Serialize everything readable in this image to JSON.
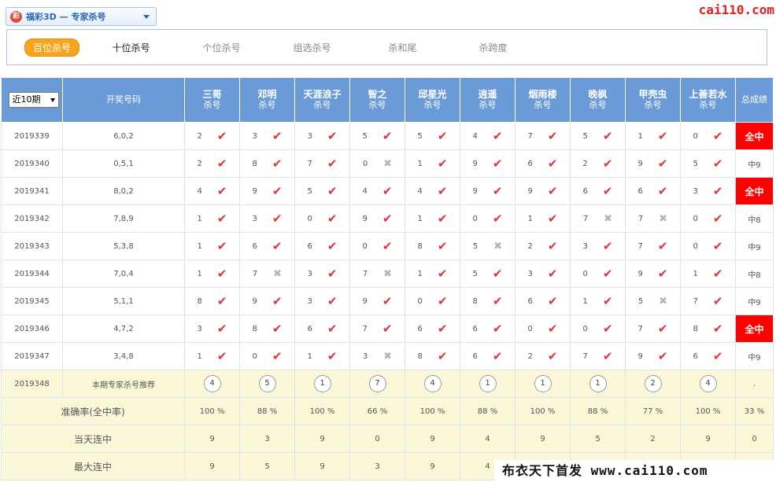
{
  "header": {
    "logo_glyph": "彩",
    "selector_text": "福彩3D — 专家杀号",
    "brand": "cai110.com"
  },
  "tabs": [
    {
      "label": "百位杀号",
      "active": true
    },
    {
      "label": "十位杀号",
      "active": false
    },
    {
      "label": "个位杀号",
      "active": false
    },
    {
      "label": "组选杀号",
      "active": false
    },
    {
      "label": "杀和尾",
      "active": false
    },
    {
      "label": "杀跨度",
      "active": false
    }
  ],
  "table": {
    "period_select": "近10期",
    "col_draw": "开奖号码",
    "col_total": "总成绩",
    "expert_sub": "杀号",
    "experts": [
      "三哥",
      "邓明",
      "天涯浪子",
      "智之",
      "邱星光",
      "逍遥",
      "烟雨楼",
      "晚枫",
      "甲壳虫",
      "上善若水"
    ],
    "rows": [
      {
        "issue": "2019339",
        "draw": "6,0,2",
        "picks": [
          [
            "2",
            true
          ],
          [
            "3",
            true
          ],
          [
            "3",
            true
          ],
          [
            "5",
            true
          ],
          [
            "5",
            true
          ],
          [
            "4",
            true
          ],
          [
            "7",
            true
          ],
          [
            "5",
            true
          ],
          [
            "1",
            true
          ],
          [
            "0",
            true
          ]
        ],
        "total": "全中",
        "full": true
      },
      {
        "issue": "2019340",
        "draw": "0,5,1",
        "picks": [
          [
            "2",
            true
          ],
          [
            "8",
            true
          ],
          [
            "7",
            true
          ],
          [
            "0",
            false
          ],
          [
            "1",
            true
          ],
          [
            "9",
            true
          ],
          [
            "6",
            true
          ],
          [
            "2",
            true
          ],
          [
            "9",
            true
          ],
          [
            "5",
            true
          ]
        ],
        "total": "中9",
        "full": false
      },
      {
        "issue": "2019341",
        "draw": "8,0,2",
        "picks": [
          [
            "4",
            true
          ],
          [
            "9",
            true
          ],
          [
            "5",
            true
          ],
          [
            "4",
            true
          ],
          [
            "4",
            true
          ],
          [
            "9",
            true
          ],
          [
            "9",
            true
          ],
          [
            "6",
            true
          ],
          [
            "6",
            true
          ],
          [
            "3",
            true
          ]
        ],
        "total": "全中",
        "full": true
      },
      {
        "issue": "2019342",
        "draw": "7,8,9",
        "picks": [
          [
            "1",
            true
          ],
          [
            "3",
            true
          ],
          [
            "0",
            true
          ],
          [
            "9",
            true
          ],
          [
            "1",
            true
          ],
          [
            "0",
            true
          ],
          [
            "1",
            true
          ],
          [
            "7",
            false
          ],
          [
            "7",
            false
          ],
          [
            "0",
            true
          ]
        ],
        "total": "中8",
        "full": false
      },
      {
        "issue": "2019343",
        "draw": "5,3,8",
        "picks": [
          [
            "1",
            true
          ],
          [
            "6",
            true
          ],
          [
            "6",
            true
          ],
          [
            "0",
            true
          ],
          [
            "8",
            true
          ],
          [
            "5",
            false
          ],
          [
            "2",
            true
          ],
          [
            "3",
            true
          ],
          [
            "7",
            true
          ],
          [
            "0",
            true
          ]
        ],
        "total": "中9",
        "full": false
      },
      {
        "issue": "2019344",
        "draw": "7,0,4",
        "picks": [
          [
            "1",
            true
          ],
          [
            "7",
            false
          ],
          [
            "3",
            true
          ],
          [
            "7",
            false
          ],
          [
            "1",
            true
          ],
          [
            "5",
            true
          ],
          [
            "3",
            true
          ],
          [
            "0",
            true
          ],
          [
            "9",
            true
          ],
          [
            "1",
            true
          ]
        ],
        "total": "中8",
        "full": false
      },
      {
        "issue": "2019345",
        "draw": "5,1,1",
        "picks": [
          [
            "8",
            true
          ],
          [
            "9",
            true
          ],
          [
            "3",
            true
          ],
          [
            "9",
            true
          ],
          [
            "0",
            true
          ],
          [
            "8",
            true
          ],
          [
            "6",
            true
          ],
          [
            "1",
            true
          ],
          [
            "5",
            false
          ],
          [
            "7",
            true
          ]
        ],
        "total": "中9",
        "full": false
      },
      {
        "issue": "2019346",
        "draw": "4,7,2",
        "picks": [
          [
            "3",
            true
          ],
          [
            "8",
            true
          ],
          [
            "6",
            true
          ],
          [
            "7",
            true
          ],
          [
            "6",
            true
          ],
          [
            "6",
            true
          ],
          [
            "0",
            true
          ],
          [
            "0",
            true
          ],
          [
            "7",
            true
          ],
          [
            "8",
            true
          ]
        ],
        "total": "全中",
        "full": true
      },
      {
        "issue": "2019347",
        "draw": "3,4,8",
        "picks": [
          [
            "1",
            true
          ],
          [
            "0",
            true
          ],
          [
            "1",
            true
          ],
          [
            "3",
            false
          ],
          [
            "8",
            true
          ],
          [
            "6",
            true
          ],
          [
            "2",
            true
          ],
          [
            "7",
            true
          ],
          [
            "9",
            true
          ],
          [
            "6",
            true
          ]
        ],
        "total": "中9",
        "full": false
      }
    ],
    "recommend": {
      "issue": "2019348",
      "label": "本期专家杀号推荐",
      "values": [
        "4",
        "5",
        "1",
        "7",
        "4",
        "1",
        "1",
        "1",
        "2",
        "4"
      ],
      "total": "."
    },
    "accuracy": {
      "label": "准确率(全中率)",
      "values": [
        "100 %",
        "88 %",
        "100 %",
        "66 %",
        "100 %",
        "88 %",
        "100 %",
        "88 %",
        "77 %",
        "100 %"
      ],
      "total": "33 %"
    },
    "today": {
      "label": "当天连中",
      "values": [
        "9",
        "3",
        "9",
        "0",
        "9",
        "4",
        "9",
        "5",
        "2",
        "9"
      ],
      "total": "0"
    },
    "max": {
      "label": "最大连中",
      "values": [
        "9",
        "5",
        "9",
        "3",
        "9",
        "4",
        "",
        "",
        "",
        "",
        ""
      ],
      "total": ""
    }
  },
  "watermark": "布衣天下首发 www.cai110.com"
}
